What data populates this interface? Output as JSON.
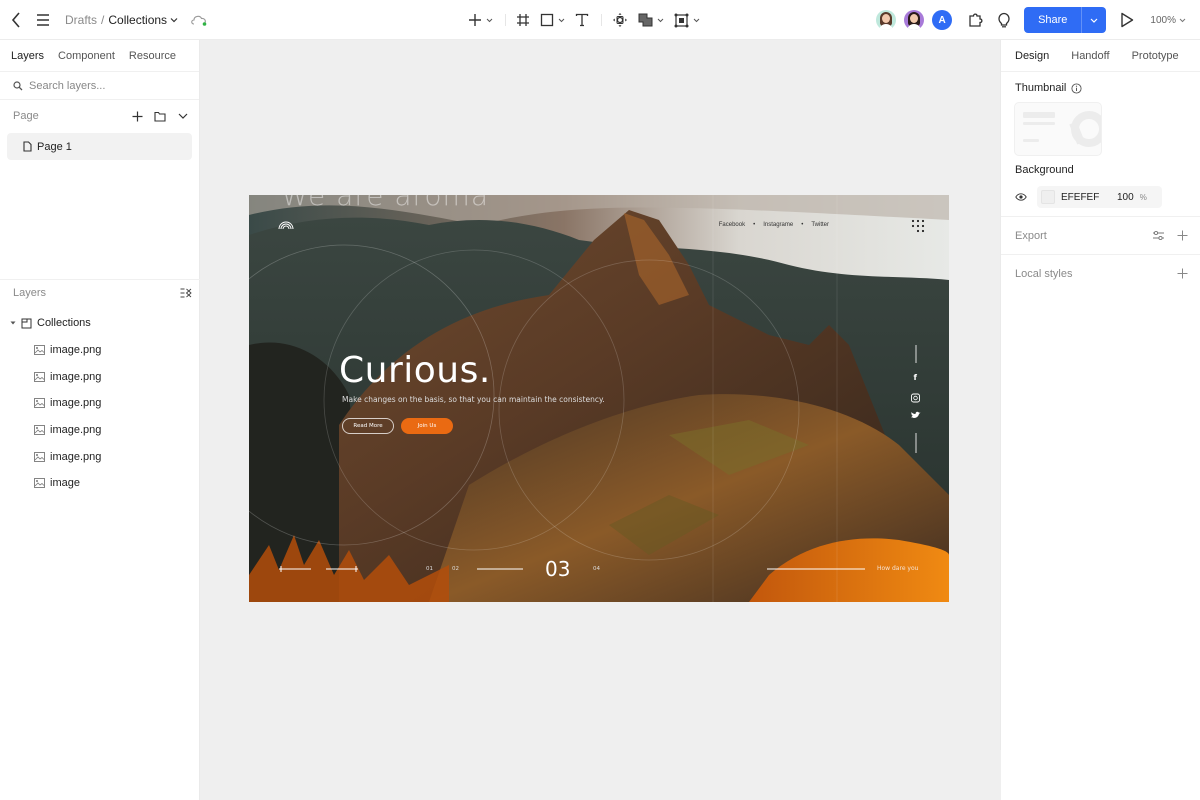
{
  "topbar": {
    "breadcrumb_root": "Drafts",
    "breadcrumb_separator": "/",
    "breadcrumb_current": "Collections",
    "sync_status": "synced",
    "tools": [
      "add",
      "frame",
      "rectangle",
      "text",
      "component",
      "boolean",
      "layout"
    ],
    "collaborators": [
      {
        "name": "collaborator-1",
        "color": "#bfe8dc"
      },
      {
        "name": "collaborator-2",
        "color": "#a87ad9"
      },
      {
        "name": "collaborator-3",
        "initial": "A",
        "color": "#2f6cf5"
      }
    ],
    "share_label": "Share",
    "zoom_level": "100%",
    "accent_color": "#2f6cf5"
  },
  "left_panel": {
    "tabs": [
      {
        "label": "Layers",
        "active": true
      },
      {
        "label": "Component",
        "active": false
      },
      {
        "label": "Resource",
        "active": false
      }
    ],
    "search_placeholder": "Search layers...",
    "pages_header": "Page",
    "pages": [
      {
        "label": "Page 1",
        "selected": true
      }
    ],
    "layers_header": "Layers",
    "layers": {
      "group": "Collections",
      "children": [
        "image.png",
        "image.png",
        "image.png",
        "image.png",
        "image.png",
        "image"
      ]
    }
  },
  "artboard": {
    "ghost_title": "We are aroma",
    "social_links": [
      "Facebook",
      "Instagrame",
      "Twitter"
    ],
    "social_separator": "•",
    "headline": "Curious.",
    "subtitle": "Make changes on the basis, so that you can maintain the consistency.",
    "btn_secondary": "Read More",
    "btn_primary": "Join Us",
    "slide_numbers": [
      "01",
      "02",
      "03",
      "04"
    ],
    "active_slide": "03",
    "tagline": "How dare you",
    "accent_color": "#ea6a12",
    "side_social_icons": [
      "facebook",
      "instagram",
      "twitter"
    ]
  },
  "right_panel": {
    "tabs": [
      {
        "label": "Design",
        "active": true
      },
      {
        "label": "Handoff",
        "active": false
      },
      {
        "label": "Prototype",
        "active": false
      }
    ],
    "thumbnail_label": "Thumbnail",
    "background_label": "Background",
    "background_hex": "EFEFEF",
    "background_opacity": "100",
    "background_opacity_unit": "%",
    "export_label": "Export",
    "local_styles_label": "Local styles"
  }
}
